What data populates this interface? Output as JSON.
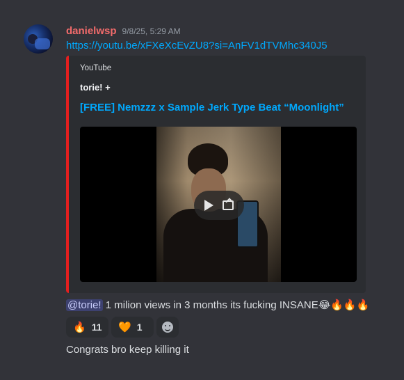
{
  "message": {
    "username": "danielwsp",
    "timestamp": "9/8/25, 5:29 AM",
    "link": "https://youtu.be/xFXeXcEvZU8?si=AnFV1dTVMhc340J5"
  },
  "embed": {
    "provider": "YouTube",
    "author": "torie! +",
    "title": "[FREE] Nemzzz x Sample Jerk Type Beat “Moonlight”",
    "accent_color": "#e41f1f"
  },
  "reply": {
    "mention": "@torie!",
    "text": " 1 milion views in 3 months its fucking INSANE",
    "emojis": "😂🔥🔥🔥"
  },
  "reactions": [
    {
      "emoji": "🔥",
      "count": "11"
    },
    {
      "emoji": "🧡",
      "count": "1"
    }
  ],
  "followup": "Congrats bro keep killing it",
  "colors": {
    "background": "#323339",
    "username": "#f36b6b",
    "link": "#00a8fc"
  }
}
